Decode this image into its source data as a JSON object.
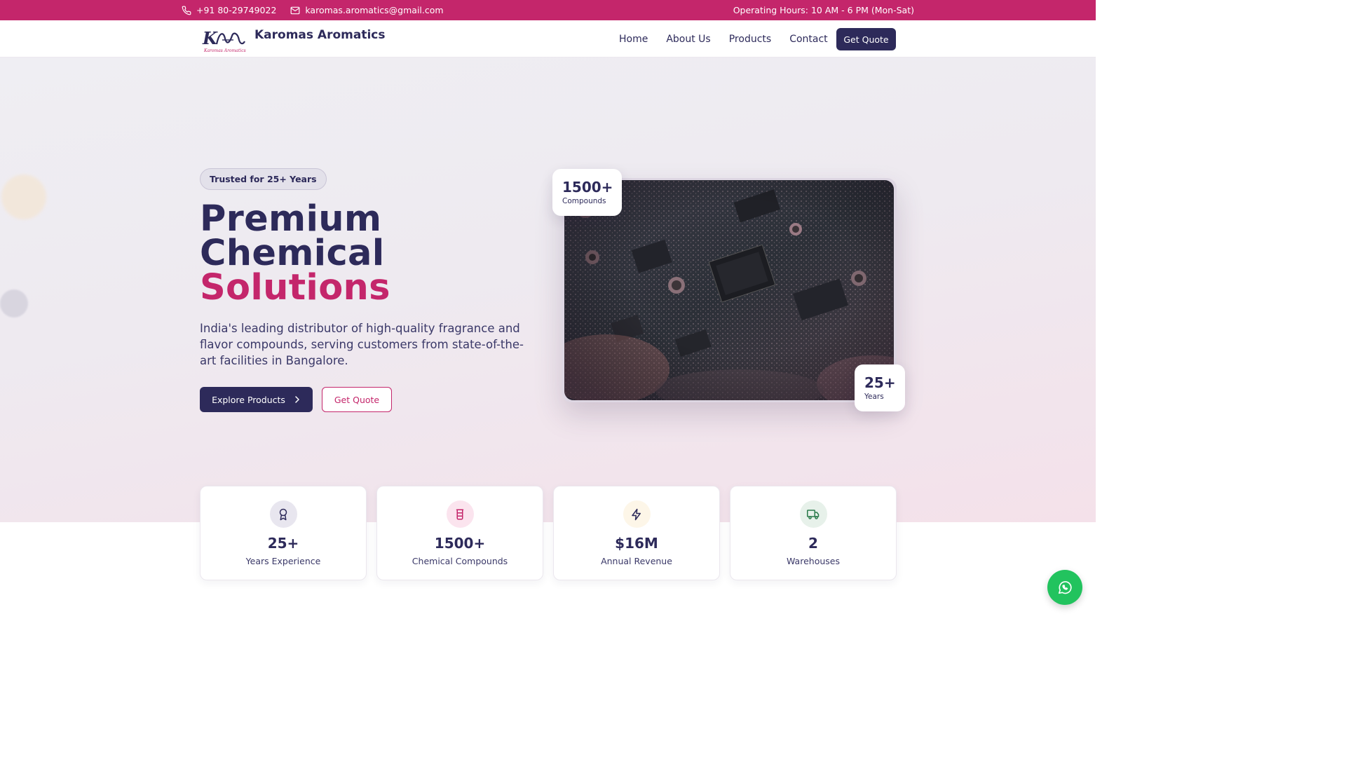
{
  "topbar": {
    "phone": "+91 80-29749022",
    "email": "karomas.aromatics@gmail.com",
    "hours": "Operating Hours: 10 AM - 6 PM (Mon-Sat)"
  },
  "nav": {
    "logo_text": "Karomas Aromatics",
    "brand": "Karomas Aromatics",
    "links": [
      "Home",
      "About Us",
      "Products",
      "Contact"
    ],
    "cta": "Get Quote"
  },
  "hero": {
    "badge": "Trusted for 25+ Years",
    "headline_line1": "Premium",
    "headline_line2": "Chemical",
    "headline_accent": "Solutions",
    "description": "India's leading distributor of high-quality fragrance and flavor compounds, serving customers from state-of-the-art facilities in Bangalore.",
    "primary_button": "Explore Products",
    "secondary_button": "Get Quote",
    "float_top": {
      "number": "1500+",
      "label": "Compounds"
    },
    "float_bottom": {
      "number": "25+",
      "label": "Years"
    }
  },
  "stats": [
    {
      "value": "25+",
      "label": "Years Experience",
      "icon": "award-icon",
      "icon_bg": "#e8e6ef",
      "icon_color": "#2d2a5a"
    },
    {
      "value": "1500+",
      "label": "Chemical Compounds",
      "icon": "beaker-icon",
      "icon_bg": "#fbe4ee",
      "icon_color": "#c4266b"
    },
    {
      "value": "$16M",
      "label": "Annual Revenue",
      "icon": "lightning-icon",
      "icon_bg": "#fdf6e8",
      "icon_color": "#2d2a5a"
    },
    {
      "value": "2",
      "label": "Warehouses",
      "icon": "truck-icon",
      "icon_bg": "#e7f1ea",
      "icon_color": "#2a7a4a"
    }
  ],
  "colors": {
    "brand_navy": "#2d2a5a",
    "brand_pink": "#c4266b",
    "whatsapp_green": "#22c35e"
  }
}
